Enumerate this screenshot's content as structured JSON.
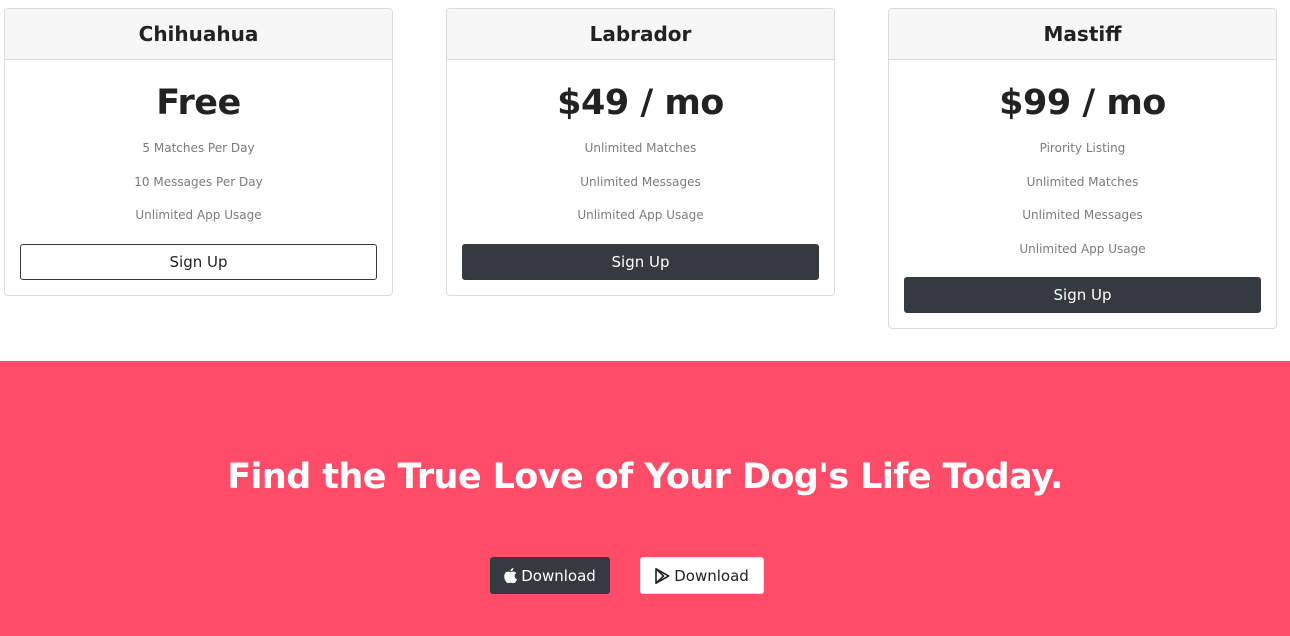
{
  "pricing": {
    "plans": [
      {
        "name": "Chihuahua",
        "price": "Free",
        "features": [
          "5 Matches Per Day",
          "10 Messages Per Day",
          "Unlimited App Usage"
        ],
        "button": "Sign Up"
      },
      {
        "name": "Labrador",
        "price": "$49 / mo",
        "features": [
          "Unlimited Matches",
          "Unlimited Messages",
          "Unlimited App Usage"
        ],
        "button": "Sign Up"
      },
      {
        "name": "Mastiff",
        "price": "$99 / mo",
        "features": [
          "Pirority Listing",
          "Unlimited Matches",
          "Unlimited Messages",
          "Unlimited App Usage"
        ],
        "button": "Sign Up"
      }
    ]
  },
  "cta": {
    "title": "Find the True Love of Your Dog's Life Today.",
    "apple_button": "Download",
    "play_button": "Download",
    "background_color": "#ff4c68",
    "dark_color": "#343a40",
    "apple_icon": "apple-icon",
    "play_icon": "google-play-icon"
  }
}
